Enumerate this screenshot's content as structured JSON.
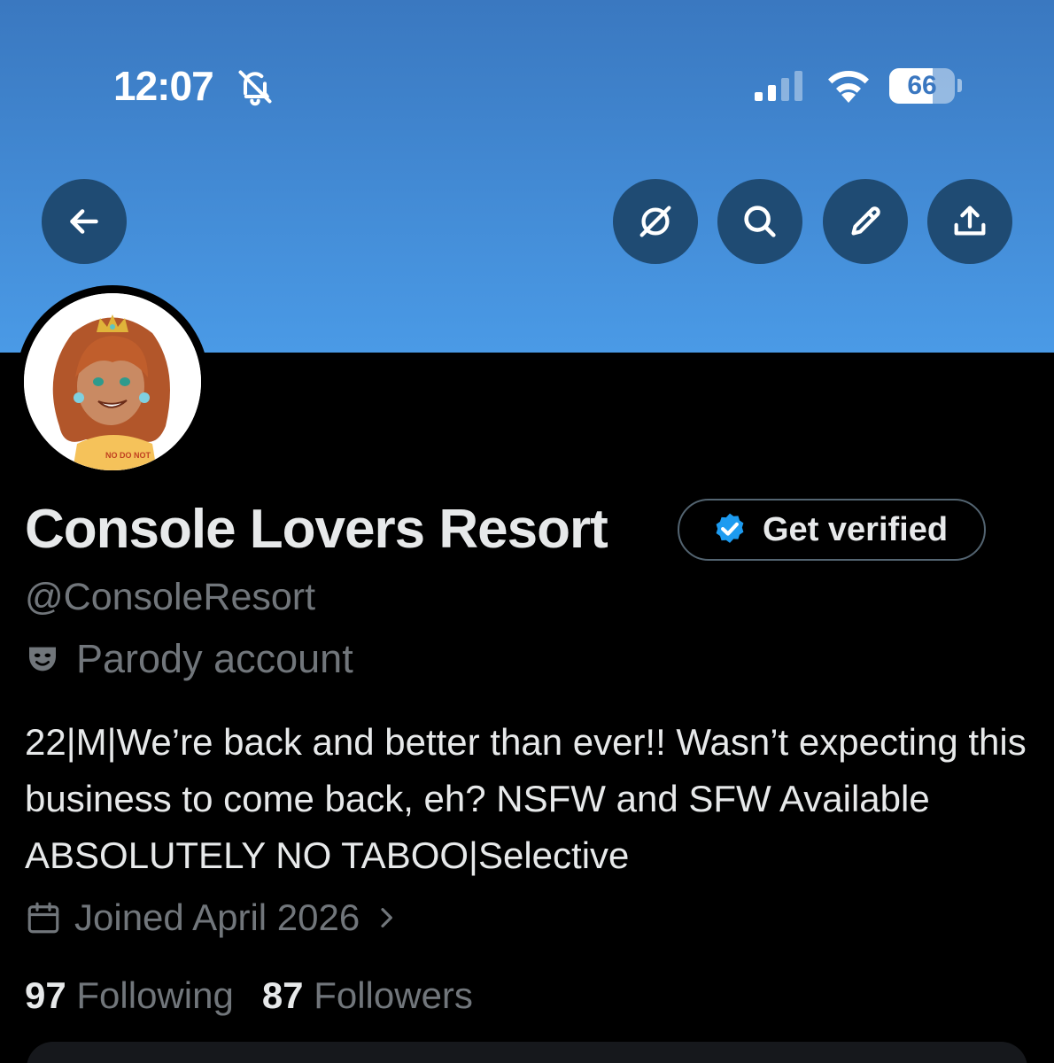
{
  "status_bar": {
    "time": "12:07",
    "battery": "66",
    "battery_level": 0.66
  },
  "colors": {
    "banner_top": "#3a78c0",
    "banner_bottom": "#4a9ae6",
    "button_bg": "#1f4b73",
    "verified_blue": "#1d9bf0",
    "muted_text": "#71767b"
  },
  "header_icons": [
    "back-arrow-icon",
    "grok-icon",
    "search-icon",
    "edit-icon",
    "share-icon"
  ],
  "profile": {
    "display_name": "Console Lovers Resort",
    "get_verified_label": "Get verified",
    "handle": "@ConsoleResort",
    "parody_label": "Parody account",
    "bio": "22|M|We’re back and better than ever!! Wasn’t expecting this business to come back, eh? NSFW and SFW Available ABSOLUTELY NO TABOO|Selective",
    "joined": "Joined April 2026",
    "following_count": "97",
    "following_label": "Following",
    "followers_count": "87",
    "followers_label": "Followers",
    "avatar_shirt_text": "NO DO NOT"
  }
}
